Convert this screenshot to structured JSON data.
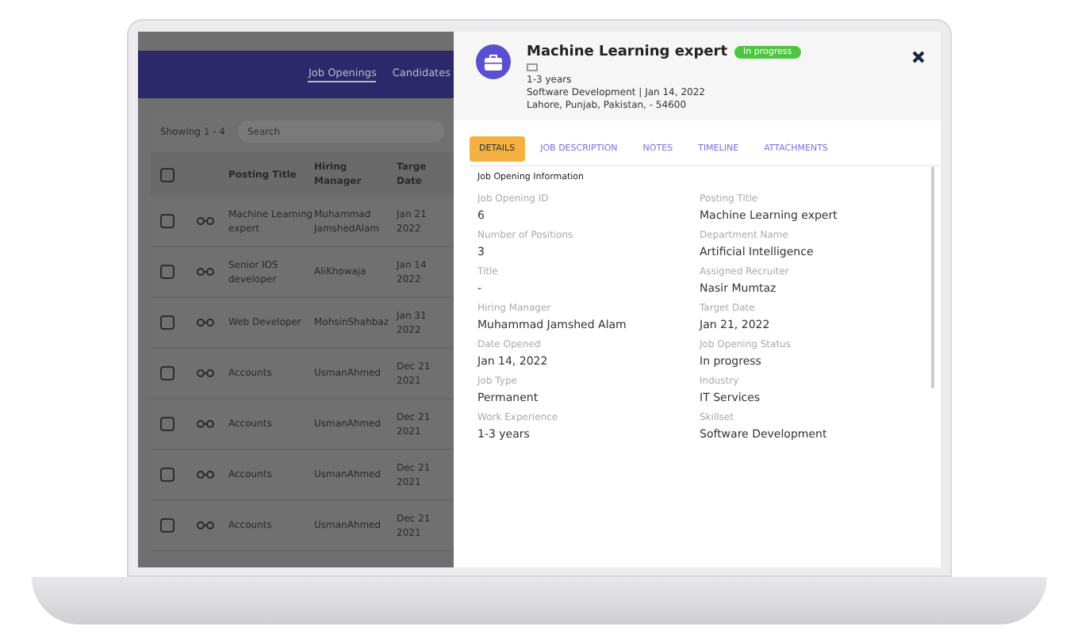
{
  "nav": [
    {
      "label": "Job Openings",
      "selected": true
    },
    {
      "label": "Candidates",
      "selected": false
    }
  ],
  "list": {
    "count": "Showing 1 - 4",
    "all_checked": false,
    "search": {
      "placeholder": "Search"
    },
    "columns": [
      "Posting Title",
      "Hiring Manager",
      "Targe Date"
    ],
    "rows": [
      {
        "checked": false,
        "title": "Machine Learning expert",
        "manager": "Muhammad JamshedAlam",
        "date": "Jan 21 2022"
      },
      {
        "checked": false,
        "title": "Senior IOS developer",
        "manager": "AliKhowaja",
        "date": "Jan 14 2022"
      },
      {
        "checked": false,
        "title": "Web Developer",
        "manager": "MohsinShahbaz",
        "date": "Jan 31 2022"
      },
      {
        "checked": false,
        "title": "Accounts",
        "manager": "UsmanAhmed",
        "date": "Dec 21 2021"
      },
      {
        "checked": false,
        "title": "Accounts",
        "manager": "UsmanAhmed",
        "date": "Dec 21 2021"
      },
      {
        "checked": false,
        "title": "Accounts",
        "manager": "UsmanAhmed",
        "date": "Dec 21 2021"
      },
      {
        "checked": false,
        "title": "Accounts",
        "manager": "UsmanAhmed",
        "date": "Dec 21 2021"
      }
    ]
  },
  "detail": {
    "title": "Machine Learning expert",
    "status": "In progress",
    "experience": "1-3 years",
    "meta": "Software Development | Jan 14, 2022",
    "location": "Lahore, Punjab, Pakistan, - 54600",
    "tabs": [
      {
        "label": "DETAILS",
        "selected": true
      },
      {
        "label": "JOB DESCRIPTION",
        "selected": false
      },
      {
        "label": "NOTES",
        "selected": false
      },
      {
        "label": "TIMELINE",
        "selected": false
      },
      {
        "label": "ATTACHMENTS",
        "selected": false
      }
    ],
    "section": "Job Opening Information",
    "fields": [
      {
        "label": "Job Opening ID",
        "value": "6"
      },
      {
        "label": "Posting Title",
        "value": "Machine Learning expert"
      },
      {
        "label": "Number of Positions",
        "value": "3"
      },
      {
        "label": "Department Name",
        "value": "Artificial Intelligence"
      },
      {
        "label": "Title",
        "value": "-"
      },
      {
        "label": "Assigned Recruiter",
        "value": "Nasir Mumtaz"
      },
      {
        "label": "Hiring Manager",
        "value": "Muhammad Jamshed Alam"
      },
      {
        "label": "Target Date",
        "value": "Jan 21, 2022"
      },
      {
        "label": "Date Opened",
        "value": "Jan 14, 2022"
      },
      {
        "label": "Job Opening Status",
        "value": "In progress"
      },
      {
        "label": "Job Type",
        "value": "Permanent"
      },
      {
        "label": "Industry",
        "value": "IT Services"
      },
      {
        "label": "Work Experience",
        "value": "1-3 years"
      },
      {
        "label": "Skillset",
        "value": "Software Development"
      }
    ]
  }
}
